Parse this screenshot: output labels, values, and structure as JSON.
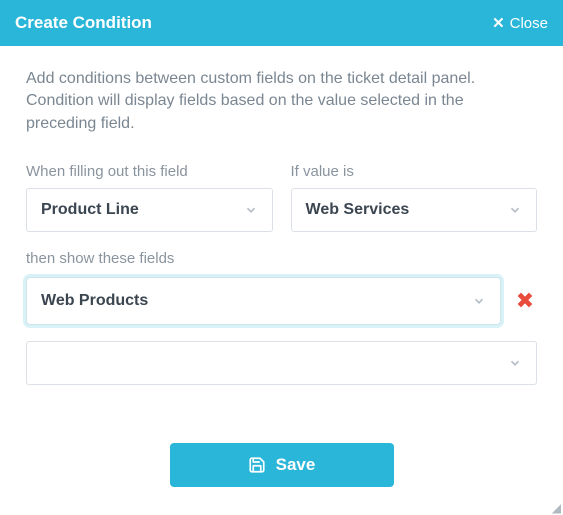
{
  "header": {
    "title": "Create Condition",
    "close_label": "Close"
  },
  "description": "Add conditions between custom fields on the ticket detail panel. Condition will display fields based on the value selected in the preceding field.",
  "fields": {
    "whenLabel": "When filling out this field",
    "whenValue": "Product Line",
    "ifLabel": "If value is",
    "ifValue": "Web Services",
    "showLabel": "then show these fields",
    "showValue1": "Web Products"
  },
  "buttons": {
    "save": "Save"
  }
}
